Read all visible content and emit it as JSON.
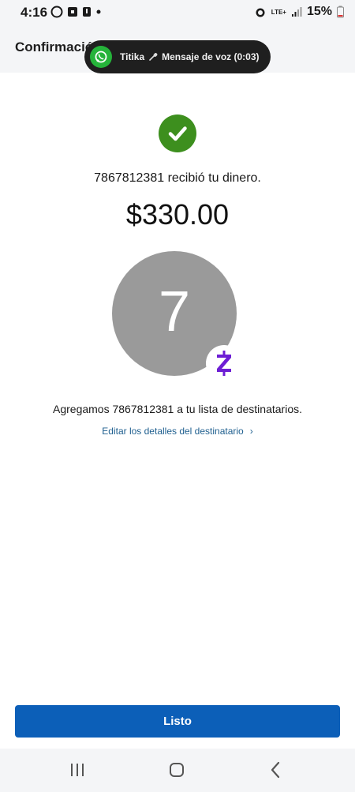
{
  "status_bar": {
    "time": "4:16",
    "network": "LTE+",
    "battery": "15%"
  },
  "header": {
    "title": "Confirmación"
  },
  "notification": {
    "app_icon": "whatsapp-icon",
    "sender": "Titika",
    "message": "Mensaje de voz (0:03)",
    "accent": "#25b33a"
  },
  "confirmation": {
    "status_icon": "checkmark-icon",
    "received_text": "7867812381 recibió tu dinero.",
    "amount": "$330.00",
    "avatar_letter": "7",
    "badge_icon": "zelle-icon",
    "added_text": "Agregamos 7867812381 a tu lista de destinatarios.",
    "edit_link": "Editar los detalles del destinatario",
    "edit_chevron": "›"
  },
  "actions": {
    "done_label": "Listo"
  },
  "colors": {
    "success": "#3d8f1e",
    "primary": "#0c5fb8",
    "link": "#1f5f8f",
    "zelle": "#6d1ed4"
  }
}
